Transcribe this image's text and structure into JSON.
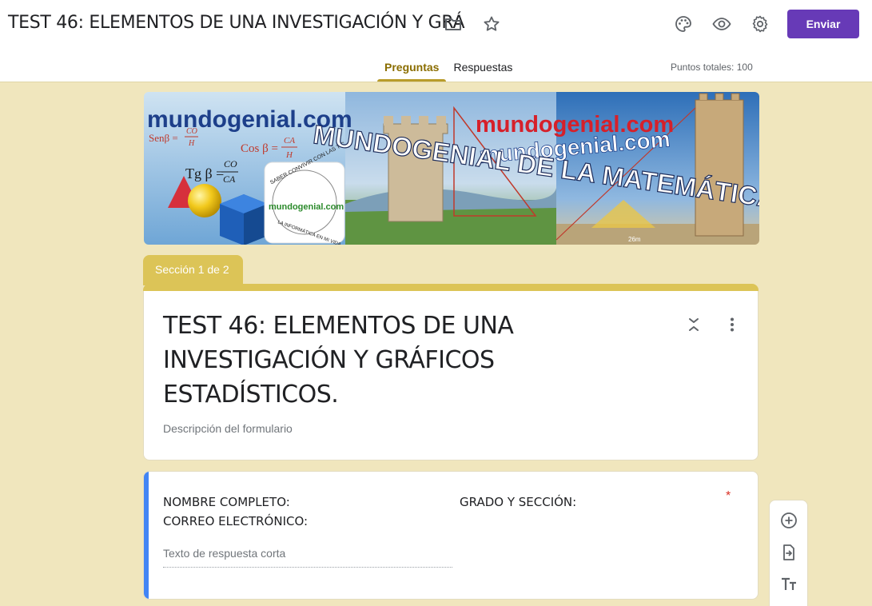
{
  "header": {
    "doc_title": "TEST 46: ELEMENTOS DE UNA INVESTIGACIÓN Y GRÁ",
    "send_label": "Enviar",
    "icons": [
      "folder-icon",
      "star-icon",
      "palette-icon",
      "preview-eye-icon",
      "settings-gear-icon"
    ],
    "accent_color": "#673ab7"
  },
  "tabs": [
    {
      "label": "Preguntas",
      "active": true
    },
    {
      "label": "Respuestas",
      "active": false
    }
  ],
  "points_total": "Puntos totales: 100",
  "banner": {
    "left_site": "mundogenial.com",
    "formula_sin": "Senβ =",
    "formula_sin_num": "CO",
    "formula_sin_den": "H",
    "formula_cos": "Cos β =",
    "formula_cos_num": "CA",
    "formula_cos_den": "H",
    "formula_tan": "Tg β =",
    "formula_tan_num": "CO",
    "formula_tan_den": "CA",
    "main_caption": "MUNDOGENIAL DE LA MATEMÁTICA",
    "red_site": "mundogenial.com",
    "white_site": "mundogenial.com",
    "badge_top": "SABER CONVIVIR CON LAS TIC",
    "badge_mid": "mundogenial.com",
    "badge_bottom": "LA INFORMÁTICA EN MI VIDA",
    "measure": "26m"
  },
  "section": {
    "label": "Sección 1 de 2",
    "color": "#dcc457"
  },
  "form": {
    "title": "TEST 46: ELEMENTOS DE UNA INVESTIGACIÓN Y GRÁFICOS ESTADÍSTICOS.",
    "description_placeholder": "Descripción del formulario"
  },
  "question": {
    "line1": "NOMBRE COMPLETO:",
    "line2": "CORREO ELECTRÓNICO:",
    "right_text": "GRADO Y SECCIÓN:",
    "required_mark": "*",
    "answer_placeholder": "Texto de respuesta corta",
    "accent_color": "#4285f4"
  },
  "side_toolbar": {
    "icons": [
      "add-question-icon",
      "import-questions-icon",
      "add-title-text-icon"
    ]
  }
}
